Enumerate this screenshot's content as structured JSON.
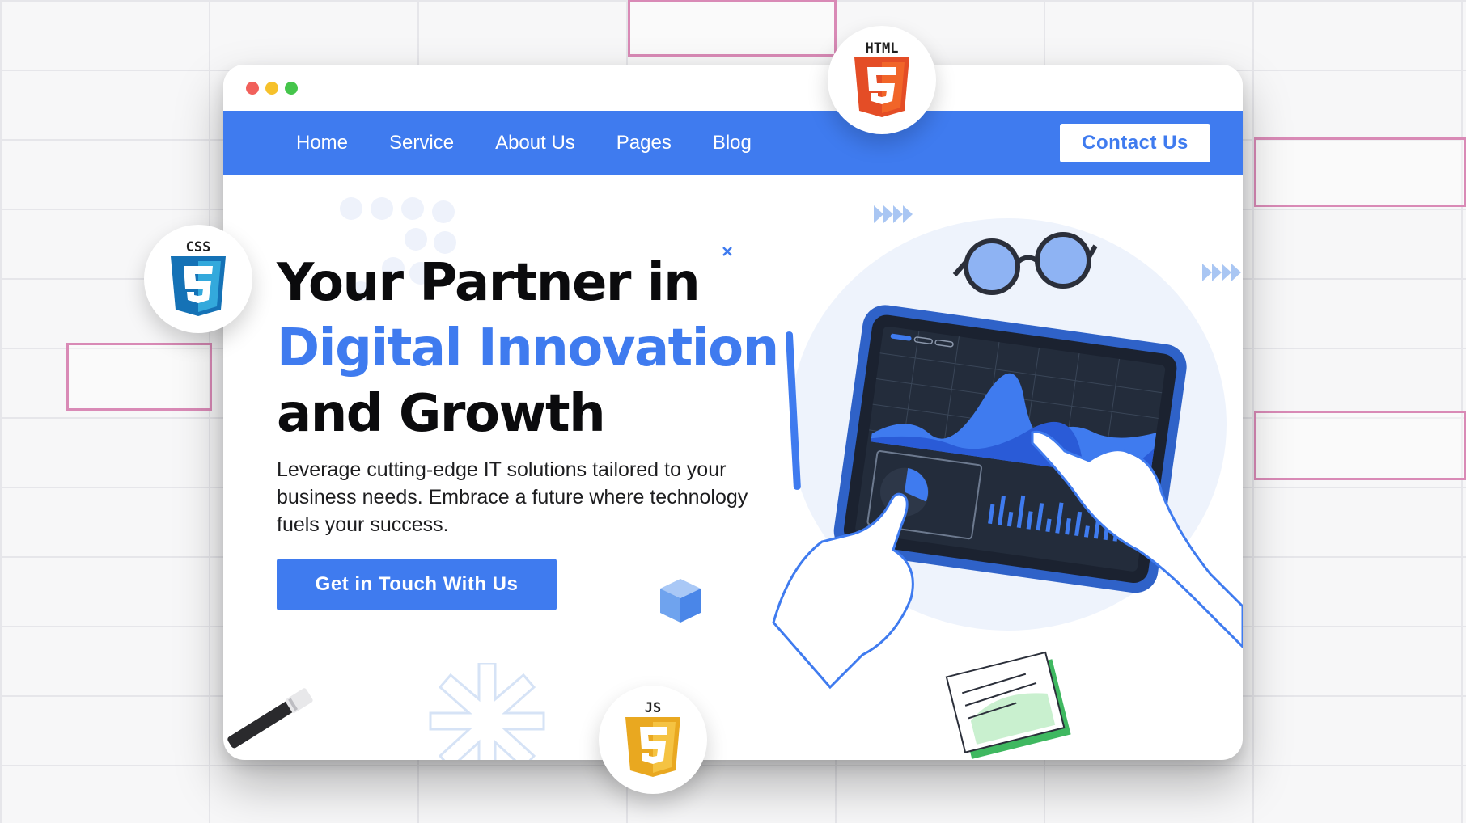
{
  "window": {
    "controls": [
      "close",
      "minimize",
      "maximize"
    ]
  },
  "navbar": {
    "links": [
      {
        "label": "Home"
      },
      {
        "label": "Service"
      },
      {
        "label": "About Us"
      },
      {
        "label": "Pages"
      },
      {
        "label": "Blog"
      }
    ],
    "contact_label": "Contact Us"
  },
  "hero": {
    "title_line1": "Your Partner in",
    "title_line2": "Digital Innovation",
    "title_line3": "and Growth",
    "description": "Leverage cutting-edge IT solutions tailored to your business needs. Embrace a future where technology fuels your success.",
    "cta_label": "Get in Touch With Us"
  },
  "badges": {
    "html": "HTML",
    "css": "CSS",
    "js": "JS"
  },
  "colors": {
    "accent": "#3f7bef",
    "html": "#e44d26",
    "css": "#2965f1",
    "js": "#f0db4f"
  },
  "icons": [
    "html5-icon",
    "css3-icon",
    "js-icon",
    "glasses-icon",
    "tablet-icon",
    "pen-icon",
    "cube-icon",
    "close-x-icon",
    "arrows-icon"
  ]
}
